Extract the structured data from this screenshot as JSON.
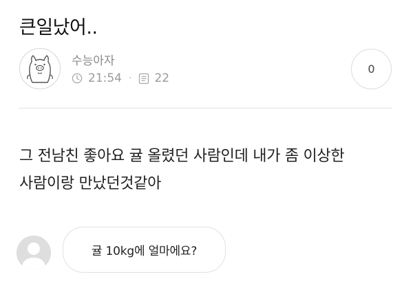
{
  "post": {
    "title": "큰일났어..",
    "author": "수능아자",
    "time": "21:54",
    "dot": "·",
    "views": "22",
    "like_count": "0",
    "body_line1": "그 전남친 좋아요 귤 올렸던 사람인데 내가 좀 이상한",
    "body_line2": "사람이랑 만났던것같아"
  },
  "comment": {
    "text": "귤 10kg에 얼마에요?"
  },
  "icons": {
    "author_avatar": "pig-character-icon",
    "time": "clock-icon",
    "views": "document-icon",
    "commenter_avatar": "default-user-icon"
  },
  "colors": {
    "meta_gray": "#9a9a9a",
    "border_gray": "#dcdcdc",
    "avatar_gray": "#dedede"
  }
}
